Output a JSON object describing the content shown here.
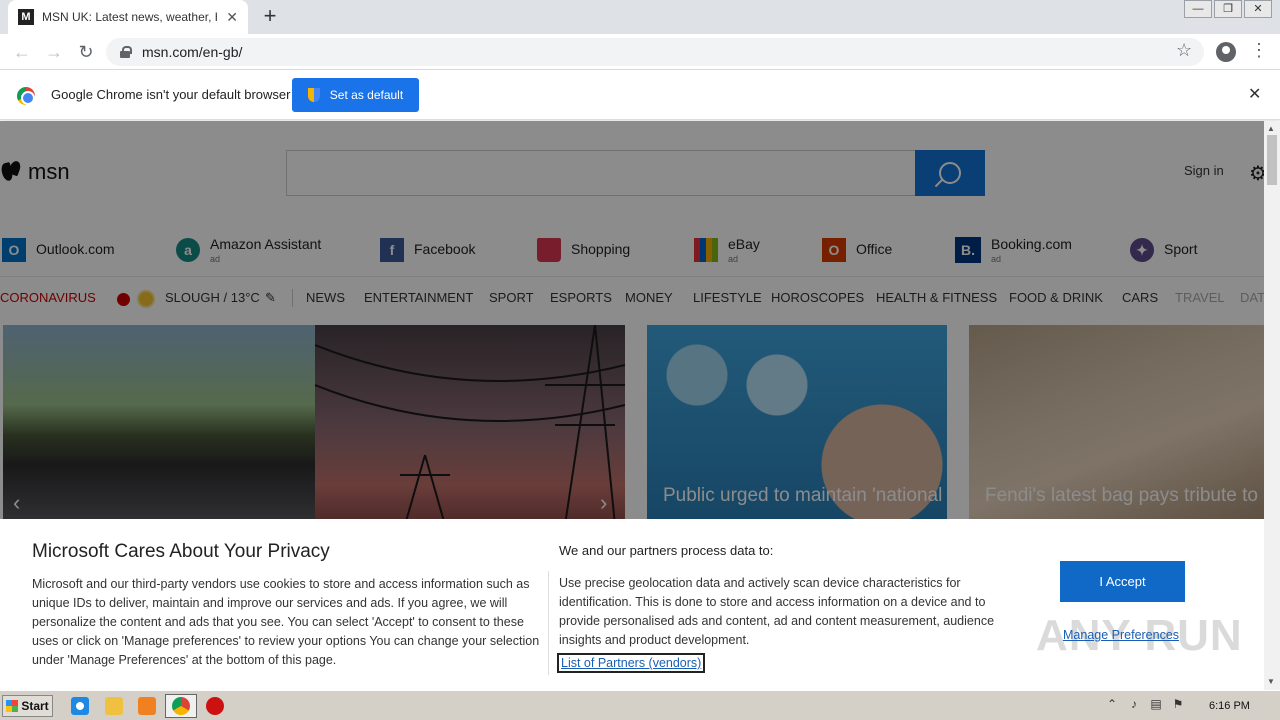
{
  "browser": {
    "tab_title": "MSN UK: Latest news, weather, Hotmail",
    "url": "msn.com/en-gb/",
    "new_tab_label": "+",
    "tab_close_label": "✕",
    "win_min": "—",
    "win_max": "❐",
    "win_close": "✕"
  },
  "infobar": {
    "message": "Google Chrome isn't your default browser",
    "set_default_label": "Set as default",
    "close_label": "✕"
  },
  "msn": {
    "logo_text": "msn",
    "sign_in": "Sign in",
    "quicklinks": [
      {
        "label": "Outlook.com",
        "ad": "",
        "icon": "outlook-icon",
        "color": "#0072c6"
      },
      {
        "label": "Amazon Assistant",
        "ad": "ad",
        "icon": "amazon-icon",
        "color": "#168b84"
      },
      {
        "label": "Facebook",
        "ad": "",
        "icon": "facebook-icon",
        "color": "#3b5998"
      },
      {
        "label": "Shopping",
        "ad": "",
        "icon": "shopping-bag-icon",
        "color": "#d9364f"
      },
      {
        "label": "eBay",
        "ad": "ad",
        "icon": "ebay-icon",
        "color": "#e53238"
      },
      {
        "label": "Office",
        "ad": "",
        "icon": "office-icon",
        "color": "#d83b01"
      },
      {
        "label": "Booking.com",
        "ad": "ad",
        "icon": "booking-icon",
        "color": "#003580"
      },
      {
        "label": "Sport",
        "ad": "",
        "icon": "sport-icon",
        "color": "#5b4b8a"
      }
    ],
    "nav": {
      "coronavirus": "CORONAVIRUS",
      "weather": "SLOUGH / 13°C",
      "items": [
        "NEWS",
        "ENTERTAINMENT",
        "SPORT",
        "ESPORTS",
        "MONEY",
        "LIFESTYLE",
        "HOROSCOPES",
        "HEALTH & FITNESS",
        "FOOD & DRINK",
        "CARS",
        "TRAVEL",
        "DAT"
      ]
    },
    "tiles": [
      {
        "caption": ""
      },
      {
        "caption": "Public urged to maintain 'national effort' in fight"
      },
      {
        "caption": "Fendi's latest bag pays tribute to Karl Lagerfeld"
      }
    ]
  },
  "privacy": {
    "title": "Microsoft Cares About Your Privacy",
    "body": "Microsoft and our third-party vendors use cookies to store and access information such as unique IDs to deliver, maintain and improve our services and ads. If you agree, we will personalize the content and ads that you see. You can select 'Accept' to consent to these uses or click on 'Manage preferences' to review your options You can change your selection under 'Manage Preferences' at the bottom of this page.",
    "subtitle": "We and our partners process data to:",
    "body2": "Use precise geolocation data and actively scan device characteristics for identification. This is done to store and access information on a device and to provide personalised ads and content, ad and content measurement, audience insights and product development.",
    "partners_link": "List of Partners (vendors)",
    "accept_label": "I Accept",
    "manage_label": "Manage Preferences"
  },
  "watermark": "ANY RUN",
  "taskbar": {
    "start_label": "Start",
    "clock": "6:16 PM"
  }
}
